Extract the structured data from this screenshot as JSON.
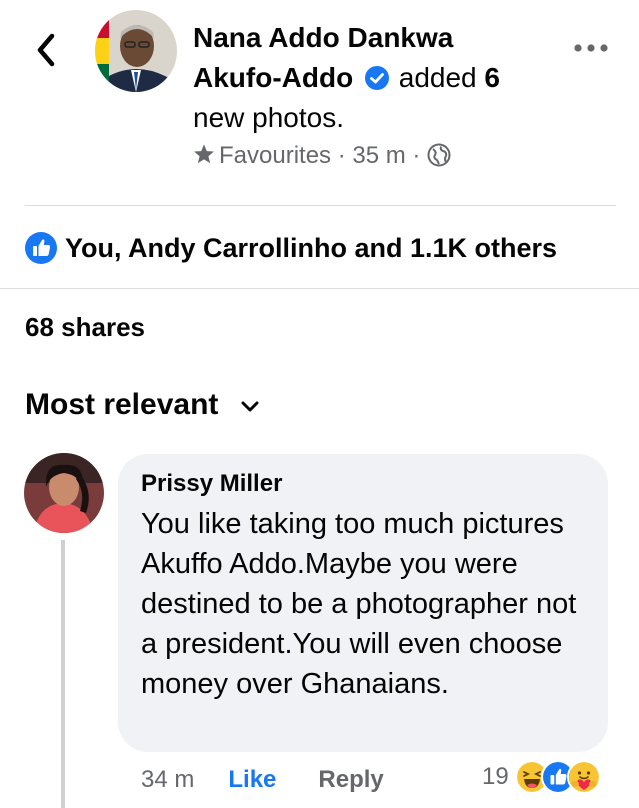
{
  "post": {
    "author_line1": "Nana Addo Dankwa",
    "author_line2": "Akufo-Addo",
    "action_text": "added",
    "photo_count": "6",
    "action_suffix": "new photos.",
    "audience": "Favourites",
    "separator": "·",
    "time": "35 m",
    "icons": {
      "back": "back-chevron-icon",
      "verified": "verified-badge-icon",
      "star": "star-icon",
      "globe": "globe-icon",
      "more": "more-options-icon"
    }
  },
  "reactions": {
    "text": "You, Andy Carrollinho and 1.1K others",
    "icon": "like-reaction-icon"
  },
  "shares": {
    "text": "68 shares"
  },
  "sort": {
    "label": "Most relevant",
    "icon": "chevron-down-icon"
  },
  "comment": {
    "author": "Prissy Miller",
    "text": "You like taking too much pictures Akuffo Addo.Maybe you were destined to be a photographer not a president.You will even choose money over Ghanaians.",
    "time": "34 m",
    "like_label": "Like",
    "reply_label": "Reply",
    "reaction_count": "19",
    "reaction_icons": [
      "haha-reaction-icon",
      "like-reaction-icon",
      "care-reaction-icon"
    ]
  },
  "colors": {
    "accent": "#1877f2",
    "secondary_text": "#65676b",
    "bubble": "#f0f2f5",
    "divider": "#dadde1"
  }
}
